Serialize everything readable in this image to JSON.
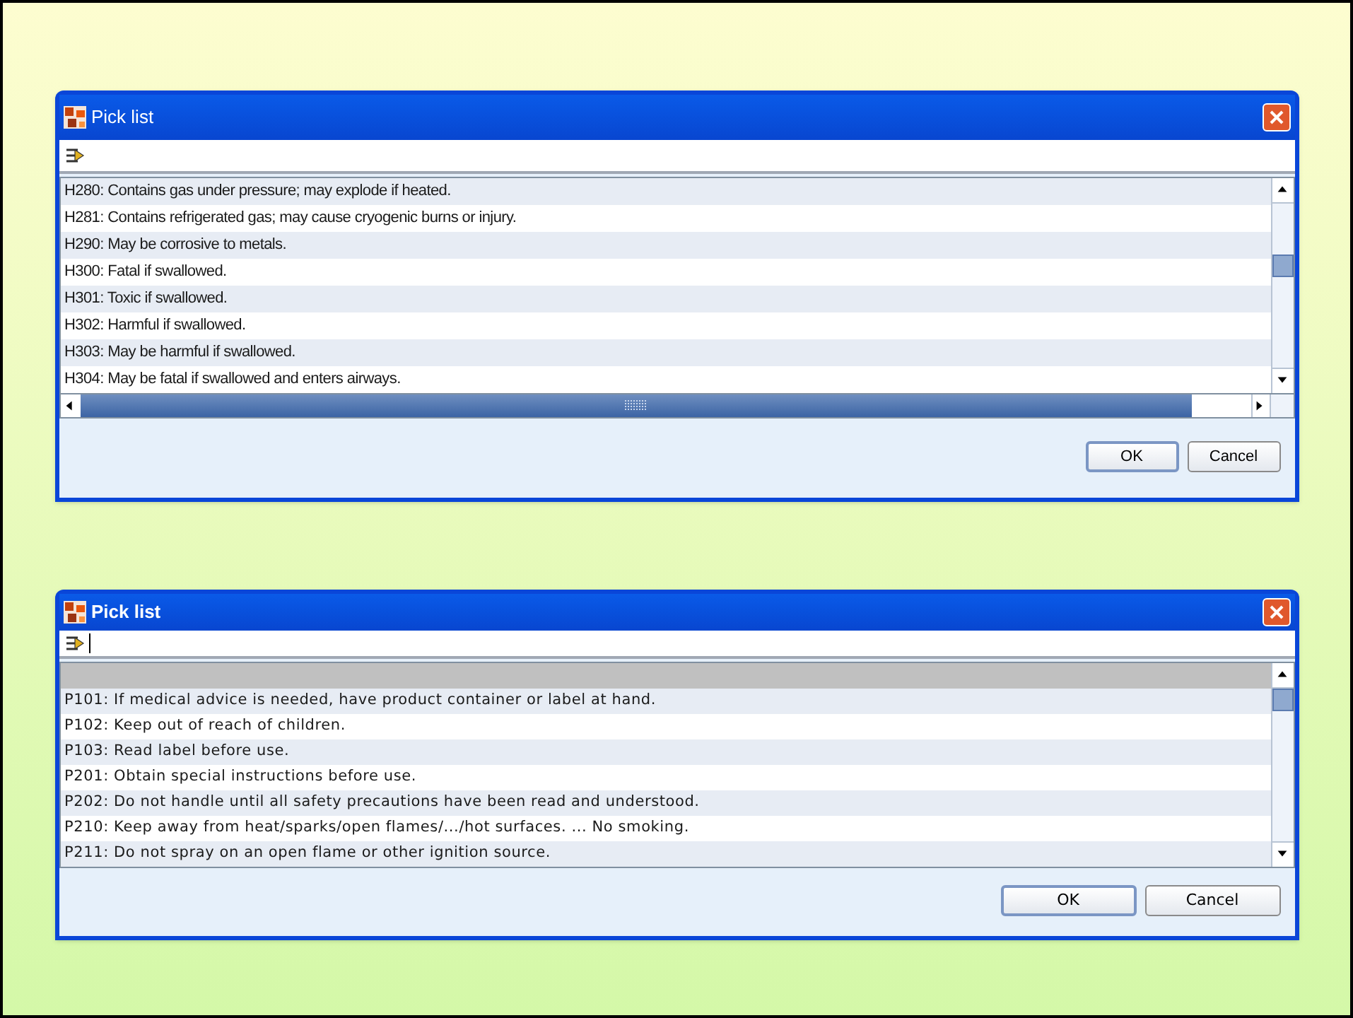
{
  "dialogs": [
    {
      "title": "Pick list",
      "rows": [
        {
          "text": "H280: Contains gas under pressure; may explode if heated."
        },
        {
          "text": "H281: Contains refrigerated gas; may cause cryogenic burns or injury."
        },
        {
          "text": "H290: May be corrosive to metals."
        },
        {
          "text": "H300: Fatal if swallowed."
        },
        {
          "text": "H301: Toxic if swallowed."
        },
        {
          "text": "H302: Harmful if swallowed."
        },
        {
          "text": "H303: May be harmful if swallowed."
        },
        {
          "text": "H304: May be fatal if swallowed and enters airways."
        }
      ],
      "buttons": [
        "OK",
        "Cancel"
      ]
    },
    {
      "title": "Pick list",
      "rows": [
        {
          "text": "P101: If medical advice is needed, have product container or label at hand."
        },
        {
          "text": "P102: Keep out of reach of children."
        },
        {
          "text": "P103: Read label before use."
        },
        {
          "text": "P201: Obtain special instructions before use."
        },
        {
          "text": "P202: Do not handle until all safety precautions have been read and understood."
        },
        {
          "text": "P210: Keep away from heat/sparks/open flames/.../hot surfaces. ... No smoking."
        },
        {
          "text": "P211: Do not spray on an open flame or other ignition source."
        }
      ],
      "buttons": [
        "OK",
        "Cancel"
      ]
    }
  ]
}
